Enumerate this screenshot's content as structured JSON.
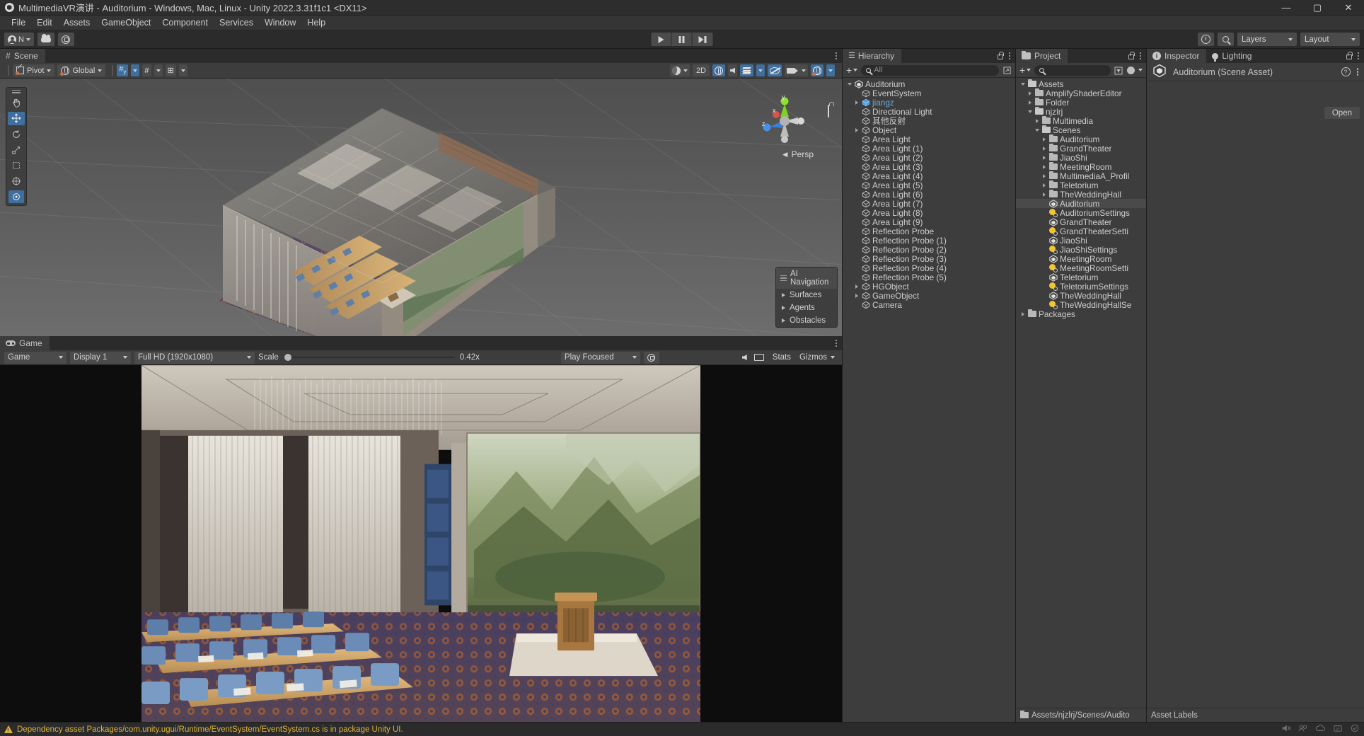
{
  "window": {
    "title": "MultimediaVR演讲 - Auditorium - Windows, Mac, Linux - Unity 2022.3.31f1c1 <DX11>",
    "minimize": "—",
    "maximize": "▢",
    "close": "✕"
  },
  "menubar": {
    "items": [
      "File",
      "Edit",
      "Assets",
      "GameObject",
      "Component",
      "Services",
      "Window",
      "Help"
    ]
  },
  "toolbar": {
    "account_label": "N",
    "account_icon": "account-icon",
    "cloud_icon": "cloud-icon",
    "settings_icon": "gear-icon",
    "play_icon": "play-icon",
    "pause_icon": "pause-icon",
    "step_icon": "step-icon",
    "history_icon": "undo-history-icon",
    "search_icon": "search-icon",
    "layers_label": "Layers",
    "layout_label": "Layout"
  },
  "scene": {
    "tab_label": "Scene",
    "tab_icon": "grid-icon",
    "pivot_label": "Pivot",
    "handle_space_label": "Global",
    "grid_snap_icon": "grid-snap-icon",
    "snap_increment_icon": "snap-increment-icon",
    "shading_icon": "shading-mode-icon",
    "mode_2d_label": "2D",
    "lighting_icon": "scene-lighting-icon",
    "audio_icon": "scene-audio-icon",
    "fx_icon": "effects-icon",
    "hidden_icon": "hidden-objects-icon",
    "camera_icon": "scene-camera-icon",
    "gizmos_icon": "gizmos-icon",
    "persp_label": "Persp",
    "gizmo_axes": {
      "x": "x",
      "y": "y",
      "z": "z"
    },
    "ai_navigation": {
      "title": "AI Navigation",
      "items": [
        "Surfaces",
        "Agents",
        "Obstacles"
      ]
    }
  },
  "game": {
    "tab_label": "Game",
    "tab_icon": "gamepad-icon",
    "mode_label": "Game",
    "display_label": "Display 1",
    "resolution_label": "Full HD (1920x1080)",
    "scale_label": "Scale",
    "scale_value": "0.42x",
    "play_mode_label": "Play Focused",
    "mute_icon": "mute-audio-icon",
    "aspect_icon": "aspect-icon",
    "stats_label": "Stats",
    "gizmos_label": "Gizmos",
    "settings_icon": "gear-icon"
  },
  "hierarchy": {
    "tab_label": "Hierarchy",
    "tab_icon": "hierarchy-icon",
    "add_label": "+",
    "search_placeholder": "All",
    "items": [
      {
        "label": "Auditorium",
        "depth": 0,
        "icon": "scene-icon",
        "expander": "open",
        "selected": false
      },
      {
        "label": "EventSystem",
        "depth": 1,
        "icon": "gameobject-icon",
        "expander": "none",
        "selected": false
      },
      {
        "label": "jiangz",
        "depth": 1,
        "icon": "prefab-icon",
        "expander": "closed",
        "selected": false,
        "prefab": true
      },
      {
        "label": "Directional Light",
        "depth": 1,
        "icon": "gameobject-icon",
        "expander": "none",
        "selected": false
      },
      {
        "label": "其他反射",
        "depth": 1,
        "icon": "gameobject-icon",
        "expander": "none",
        "selected": false
      },
      {
        "label": "Object",
        "depth": 1,
        "icon": "gameobject-icon",
        "expander": "closed",
        "selected": false
      },
      {
        "label": "Area Light",
        "depth": 1,
        "icon": "gameobject-icon",
        "expander": "none",
        "selected": false
      },
      {
        "label": "Area Light (1)",
        "depth": 1,
        "icon": "gameobject-icon",
        "expander": "none",
        "selected": false
      },
      {
        "label": "Area Light (2)",
        "depth": 1,
        "icon": "gameobject-icon",
        "expander": "none",
        "selected": false
      },
      {
        "label": "Area Light (3)",
        "depth": 1,
        "icon": "gameobject-icon",
        "expander": "none",
        "selected": false
      },
      {
        "label": "Area Light (4)",
        "depth": 1,
        "icon": "gameobject-icon",
        "expander": "none",
        "selected": false
      },
      {
        "label": "Area Light (5)",
        "depth": 1,
        "icon": "gameobject-icon",
        "expander": "none",
        "selected": false
      },
      {
        "label": "Area Light (6)",
        "depth": 1,
        "icon": "gameobject-icon",
        "expander": "none",
        "selected": false
      },
      {
        "label": "Area Light (7)",
        "depth": 1,
        "icon": "gameobject-icon",
        "expander": "none",
        "selected": false
      },
      {
        "label": "Area Light (8)",
        "depth": 1,
        "icon": "gameobject-icon",
        "expander": "none",
        "selected": false
      },
      {
        "label": "Area Light (9)",
        "depth": 1,
        "icon": "gameobject-icon",
        "expander": "none",
        "selected": false
      },
      {
        "label": "Reflection Probe",
        "depth": 1,
        "icon": "gameobject-icon",
        "expander": "none",
        "selected": false
      },
      {
        "label": "Reflection Probe (1)",
        "depth": 1,
        "icon": "gameobject-icon",
        "expander": "none",
        "selected": false
      },
      {
        "label": "Reflection Probe (2)",
        "depth": 1,
        "icon": "gameobject-icon",
        "expander": "none",
        "selected": false
      },
      {
        "label": "Reflection Probe (3)",
        "depth": 1,
        "icon": "gameobject-icon",
        "expander": "none",
        "selected": false
      },
      {
        "label": "Reflection Probe (4)",
        "depth": 1,
        "icon": "gameobject-icon",
        "expander": "none",
        "selected": false
      },
      {
        "label": "Reflection Probe (5)",
        "depth": 1,
        "icon": "gameobject-icon",
        "expander": "none",
        "selected": false
      },
      {
        "label": "HGObject",
        "depth": 1,
        "icon": "gameobject-icon",
        "expander": "closed",
        "selected": false
      },
      {
        "label": "GameObject",
        "depth": 1,
        "icon": "gameobject-icon",
        "expander": "closed",
        "selected": false
      },
      {
        "label": "Camera",
        "depth": 1,
        "icon": "gameobject-icon",
        "expander": "none",
        "selected": false
      }
    ]
  },
  "project": {
    "tab_label": "Project",
    "tab_icon": "folder-icon",
    "add_label": "+",
    "search_placeholder": "",
    "footer_path": "Assets/njzlrj/Scenes/Audito",
    "items": [
      {
        "label": "Assets",
        "depth": 0,
        "icon": "folder-open-icon",
        "expander": "open",
        "selected": false
      },
      {
        "label": "AmplifyShaderEditor",
        "depth": 1,
        "icon": "folder-icon",
        "expander": "closed",
        "selected": false
      },
      {
        "label": "Folder",
        "depth": 1,
        "icon": "folder-icon",
        "expander": "closed",
        "selected": false
      },
      {
        "label": "njzlrj",
        "depth": 1,
        "icon": "folder-open-icon",
        "expander": "open",
        "selected": false
      },
      {
        "label": "Multimedia",
        "depth": 2,
        "icon": "folder-icon",
        "expander": "closed",
        "selected": false
      },
      {
        "label": "Scenes",
        "depth": 2,
        "icon": "folder-open-icon",
        "expander": "open",
        "selected": false
      },
      {
        "label": "Auditorium",
        "depth": 3,
        "icon": "folder-icon",
        "expander": "closed",
        "selected": false
      },
      {
        "label": "GrandTheater",
        "depth": 3,
        "icon": "folder-icon",
        "expander": "closed",
        "selected": false
      },
      {
        "label": "JiaoShi",
        "depth": 3,
        "icon": "folder-icon",
        "expander": "closed",
        "selected": false
      },
      {
        "label": "MeetingRoom",
        "depth": 3,
        "icon": "folder-icon",
        "expander": "closed",
        "selected": false
      },
      {
        "label": "MultimediaA_Profil",
        "depth": 3,
        "icon": "folder-icon",
        "expander": "closed",
        "selected": false
      },
      {
        "label": "Teletorium",
        "depth": 3,
        "icon": "folder-icon",
        "expander": "closed",
        "selected": false
      },
      {
        "label": "TheWeddingHall",
        "depth": 3,
        "icon": "folder-icon",
        "expander": "closed",
        "selected": false
      },
      {
        "label": "Auditorium",
        "depth": 3,
        "icon": "scene-asset-icon",
        "expander": "none",
        "selected": true
      },
      {
        "label": "AuditoriumSettings",
        "depth": 3,
        "icon": "lighting-settings-icon",
        "expander": "none",
        "selected": false
      },
      {
        "label": "GrandTheater",
        "depth": 3,
        "icon": "scene-asset-icon",
        "expander": "none",
        "selected": false
      },
      {
        "label": "GrandTheaterSetti",
        "depth": 3,
        "icon": "lighting-settings-icon",
        "expander": "none",
        "selected": false
      },
      {
        "label": "JiaoShi",
        "depth": 3,
        "icon": "scene-asset-icon",
        "expander": "none",
        "selected": false
      },
      {
        "label": "JiaoShiSettings",
        "depth": 3,
        "icon": "lighting-settings-icon",
        "expander": "none",
        "selected": false
      },
      {
        "label": "MeetingRoom",
        "depth": 3,
        "icon": "scene-asset-icon",
        "expander": "none",
        "selected": false
      },
      {
        "label": "MeetingRoomSetti",
        "depth": 3,
        "icon": "lighting-settings-icon",
        "expander": "none",
        "selected": false
      },
      {
        "label": "Teletorium",
        "depth": 3,
        "icon": "scene-asset-icon",
        "expander": "none",
        "selected": false
      },
      {
        "label": "TeletoriumSettings",
        "depth": 3,
        "icon": "lighting-settings-icon",
        "expander": "none",
        "selected": false
      },
      {
        "label": "TheWeddingHall",
        "depth": 3,
        "icon": "scene-asset-icon",
        "expander": "none",
        "selected": false
      },
      {
        "label": "TheWeddingHallSe",
        "depth": 3,
        "icon": "lighting-settings-icon",
        "expander": "none",
        "selected": false
      },
      {
        "label": "Packages",
        "depth": 0,
        "icon": "folder-icon",
        "expander": "closed",
        "selected": false
      }
    ]
  },
  "inspector": {
    "tab_label": "Inspector",
    "tab_icon": "info-icon",
    "lighting_tab_label": "Lighting",
    "lighting_tab_icon": "lightbulb-icon",
    "asset_title": "Auditorium (Scene Asset)",
    "asset_icon": "scene-asset-icon",
    "help_icon": "help-icon",
    "open_button": "Open",
    "labels_footer": "Asset Labels"
  },
  "statusbar": {
    "message": "Dependency asset Packages/com.unity.ugui/Runtime/EventSystem/EventSystem.cs is in package Unity UI.",
    "warning_icon": "warning-icon",
    "right_icons": [
      "mute-icon",
      "collab-icon",
      "cloud-icon",
      "api-icon",
      "check-icon"
    ]
  },
  "colors": {
    "accent_blue": "#3f6f9f",
    "panel_bg": "#3d3d3d",
    "toolbar_bg": "#2b2b2b",
    "warning": "#e0b23a",
    "prefab_blue": "#6ea9de",
    "lighting_yellow": "#f2c531"
  }
}
